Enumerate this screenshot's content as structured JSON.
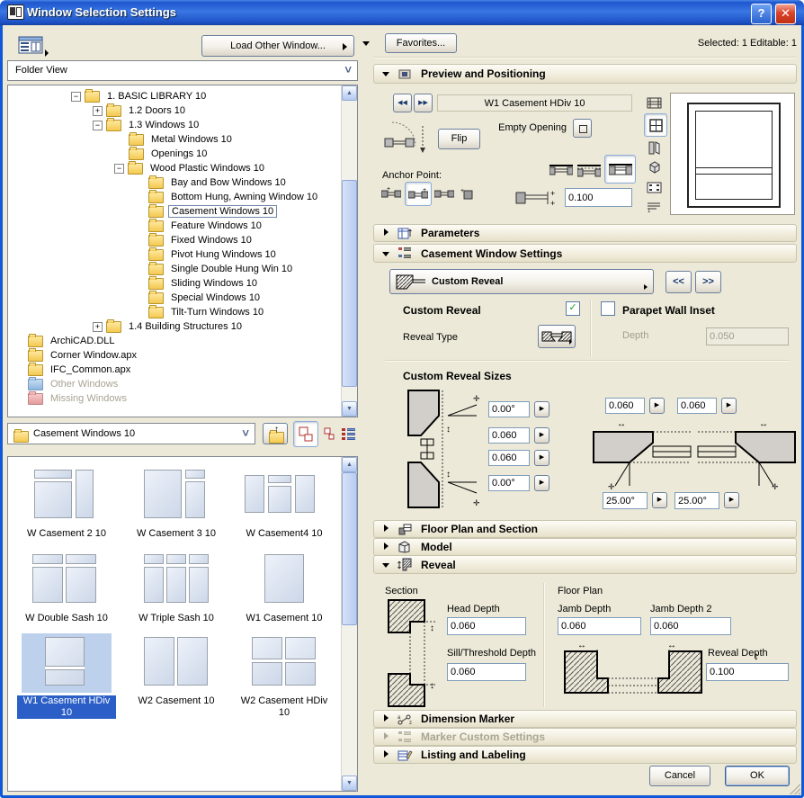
{
  "window": {
    "title": "Window Selection Settings"
  },
  "icons": {
    "help": "?",
    "close": "✕",
    "prev_item": "◀◀",
    "next_item": "▶▶",
    "submenu_arrow": "▶",
    "flyout_down": "▼",
    "chevron_down": "˅",
    "scroll_up": "▲",
    "scroll_down": "▼",
    "spin_arrow": "▶",
    "up_arrow": "↑"
  },
  "left": {
    "load_other_button": "Load Other Window...",
    "folder_view_value": "Folder View",
    "tree": {
      "items": [
        {
          "label": "1. BASIC LIBRARY 10",
          "level": 1,
          "expander": "minus",
          "folder": "yellow"
        },
        {
          "label": "1.2 Doors 10",
          "level": 2,
          "expander": "plus",
          "folder": "yellow"
        },
        {
          "label": "1.3 Windows 10",
          "level": 2,
          "expander": "minus",
          "folder": "yellow"
        },
        {
          "label": "Metal Windows 10",
          "level": 3,
          "folder": "yellow"
        },
        {
          "label": "Openings 10",
          "level": 3,
          "folder": "yellow"
        },
        {
          "label": "Wood Plastic Windows 10",
          "level": 3,
          "expander": "minus",
          "folder": "yellow"
        },
        {
          "label": "Bay and Bow Windows 10",
          "level": 4,
          "folder": "yellow"
        },
        {
          "label": "Bottom Hung, Awning Window 10",
          "level": 4,
          "folder": "yellow"
        },
        {
          "label": "Casement Windows 10",
          "level": 4,
          "folder": "yellow",
          "selected": true
        },
        {
          "label": "Feature Windows 10",
          "level": 4,
          "folder": "yellow"
        },
        {
          "label": "Fixed Windows 10",
          "level": 4,
          "folder": "yellow"
        },
        {
          "label": "Pivot Hung Windows 10",
          "level": 4,
          "folder": "yellow"
        },
        {
          "label": "Single Double Hung Win 10",
          "level": 4,
          "folder": "yellow"
        },
        {
          "label": "Sliding Windows 10",
          "level": 4,
          "folder": "yellow"
        },
        {
          "label": "Special Windows 10",
          "level": 4,
          "folder": "yellow"
        },
        {
          "label": "Tilt-Turn Windows 10",
          "level": 4,
          "folder": "yellow"
        },
        {
          "label": "1.4 Building Structures 10",
          "level": 2,
          "expander": "plus",
          "folder": "yellow"
        },
        {
          "label": "ArchiCAD.DLL",
          "level": 0,
          "folder": "yellow"
        },
        {
          "label": "Corner Window.apx",
          "level": 0,
          "folder": "yellow"
        },
        {
          "label": "IFC_Common.apx",
          "level": 0,
          "folder": "yellow"
        },
        {
          "label": "Other Windows",
          "level": 0,
          "folder": "blue",
          "grayed": true
        },
        {
          "label": "Missing Windows",
          "level": 0,
          "folder": "pink",
          "grayed": true
        }
      ]
    },
    "current_folder_value": "Casement Windows 10",
    "thumbnails": {
      "items": [
        {
          "label": "W Casement 2 10",
          "icon": "casement-2"
        },
        {
          "label": "W Casement 3 10",
          "icon": "casement-3"
        },
        {
          "label": "W Casement4 10",
          "icon": "casement-4"
        },
        {
          "label": "W Double Sash 10",
          "icon": "double-sash"
        },
        {
          "label": "W Triple Sash 10",
          "icon": "triple-sash"
        },
        {
          "label": "W1 Casement 10",
          "icon": "w1-casement"
        },
        {
          "label": "W1 Casement HDiv 10",
          "icon": "w1-casement-hdiv",
          "selected": true
        },
        {
          "label": "W2 Casement 10",
          "icon": "w2-casement"
        },
        {
          "label": "W2 Casement HDiv 10",
          "icon": "w2-casement-hdiv"
        }
      ]
    }
  },
  "right": {
    "favorites_button": "Favorites...",
    "selection_status": "Selected: 1 Editable: 1",
    "preview": {
      "header": "Preview and Positioning",
      "item_name": "W1 Casement HDiv 10",
      "flip_button": "Flip",
      "empty_opening_label": "Empty Opening",
      "anchor_point_label": "Anchor Point:",
      "sill_depth_value": "0.100"
    },
    "parameters": {
      "header": "Parameters"
    },
    "casement": {
      "header": "Casement Window Settings",
      "preset_value": "Custom Reveal",
      "prev_button": "<<",
      "next_button": ">>",
      "custom_reveal_label": "Custom Reveal",
      "custom_reveal_checked": true,
      "parapet_label": "Parapet Wall Inset",
      "parapet_checked": false,
      "reveal_type_label": "Reveal Type",
      "depth_label": "Depth",
      "depth_value": "0.050",
      "sizes_title": "Custom Reveal Sizes",
      "sizes": {
        "top_angle": "0.00°",
        "upper": "0.060",
        "lower": "0.060",
        "bottom_angle": "0.00°",
        "jamb_left": "0.060",
        "jamb_right": "0.060",
        "angle_left": "25.00°",
        "angle_right": "25.00°"
      }
    },
    "floor_plan_section": {
      "header": "Floor Plan and Section"
    },
    "model": {
      "header": "Model"
    },
    "reveal": {
      "header": "Reveal",
      "section_label": "Section",
      "head_depth_label": "Head Depth",
      "head_depth_value": "0.060",
      "sill_threshold_label": "Sill/Threshold Depth",
      "sill_threshold_value": "0.060",
      "floor_plan_label": "Floor Plan",
      "jamb_depth_label": "Jamb Depth",
      "jamb_depth_value": "0.060",
      "jamb_depth2_label": "Jamb Depth 2",
      "jamb_depth2_value": "0.060",
      "reveal_depth_label": "Reveal Depth",
      "reveal_depth_value": "0.100"
    },
    "dimension_marker": {
      "header": "Dimension Marker"
    },
    "marker_custom": {
      "header": "Marker Custom Settings"
    },
    "listing": {
      "header": "Listing and Labeling"
    },
    "cancel_button": "Cancel",
    "ok_button": "OK"
  }
}
